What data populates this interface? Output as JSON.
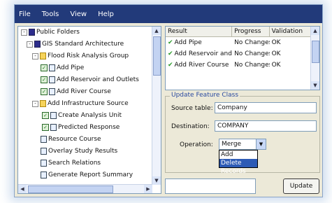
{
  "menu": [
    "File",
    "Tools",
    "View",
    "Help"
  ],
  "tree": {
    "nodes": [
      {
        "label": "Public Folders",
        "icon": "db",
        "toggle": "-",
        "check": false
      },
      {
        "label": "GIS Standard Architecture",
        "icon": "db",
        "toggle": "-",
        "check": false
      },
      {
        "label": "Flood Risk Analysis Group",
        "icon": "folder",
        "toggle": "-",
        "check": false
      },
      {
        "label": "Add Pipe",
        "icon": "note",
        "toggle": "",
        "check": true
      },
      {
        "label": "Add Reservoir and Outlets",
        "icon": "note",
        "toggle": "",
        "check": true
      },
      {
        "label": "Add River Course",
        "icon": "note",
        "toggle": "",
        "check": true
      },
      {
        "label": "Add Infrastructure Source",
        "icon": "folder",
        "toggle": "-",
        "check": false
      },
      {
        "label": "Create Analysis Unit",
        "icon": "note",
        "toggle": "",
        "check": true
      },
      {
        "label": "Predicted Response",
        "icon": "note",
        "toggle": "",
        "check": true
      },
      {
        "label": "Resource Course",
        "icon": "note",
        "toggle": "",
        "check": false
      },
      {
        "label": "Overlay Study Results",
        "icon": "note",
        "toggle": "",
        "check": false
      },
      {
        "label": "Search Relations",
        "icon": "note",
        "toggle": "",
        "check": false
      },
      {
        "label": "Generate Report Summary",
        "icon": "note",
        "toggle": "",
        "check": false
      }
    ]
  },
  "results": {
    "headers": [
      "Result",
      "Progress",
      "Validation"
    ],
    "rows": [
      {
        "result": "Add Pipe",
        "progress": "No Changes",
        "validation": "OK"
      },
      {
        "result": "Add Reservoir and Outlets",
        "progress": "No Changes",
        "validation": "OK"
      },
      {
        "result": "Add River Course",
        "progress": "No Changes",
        "validation": "OK"
      }
    ]
  },
  "group": {
    "title": "Update Feature Class",
    "source_label": "Source table:",
    "source_value": "Company",
    "destination_label": "Destination:",
    "destination_value": "COMPANY",
    "operation_label": "Operation:",
    "operation_value": "Merge Operation",
    "options": [
      "Add",
      "Delete Records"
    ]
  },
  "bottom": {
    "input_value": "",
    "button_label": "Update Records"
  }
}
